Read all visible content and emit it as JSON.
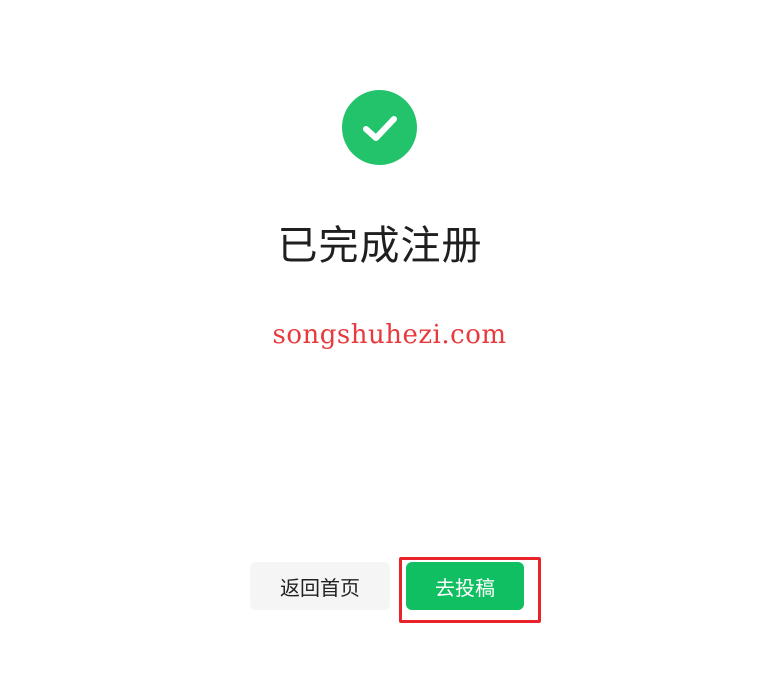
{
  "colors": {
    "success_green": "#22c36b",
    "button_green": "#0fbf61",
    "home_button_bg": "#f5f5f5",
    "watermark_red": "#e8393c",
    "highlight_red": "#e8232b"
  },
  "icon": {
    "name": "check-circle-icon"
  },
  "page": {
    "title": "已完成注册",
    "watermark": "songshuhezi.com"
  },
  "actions": {
    "home_label": "返回首页",
    "submit_label": "去投稿"
  }
}
